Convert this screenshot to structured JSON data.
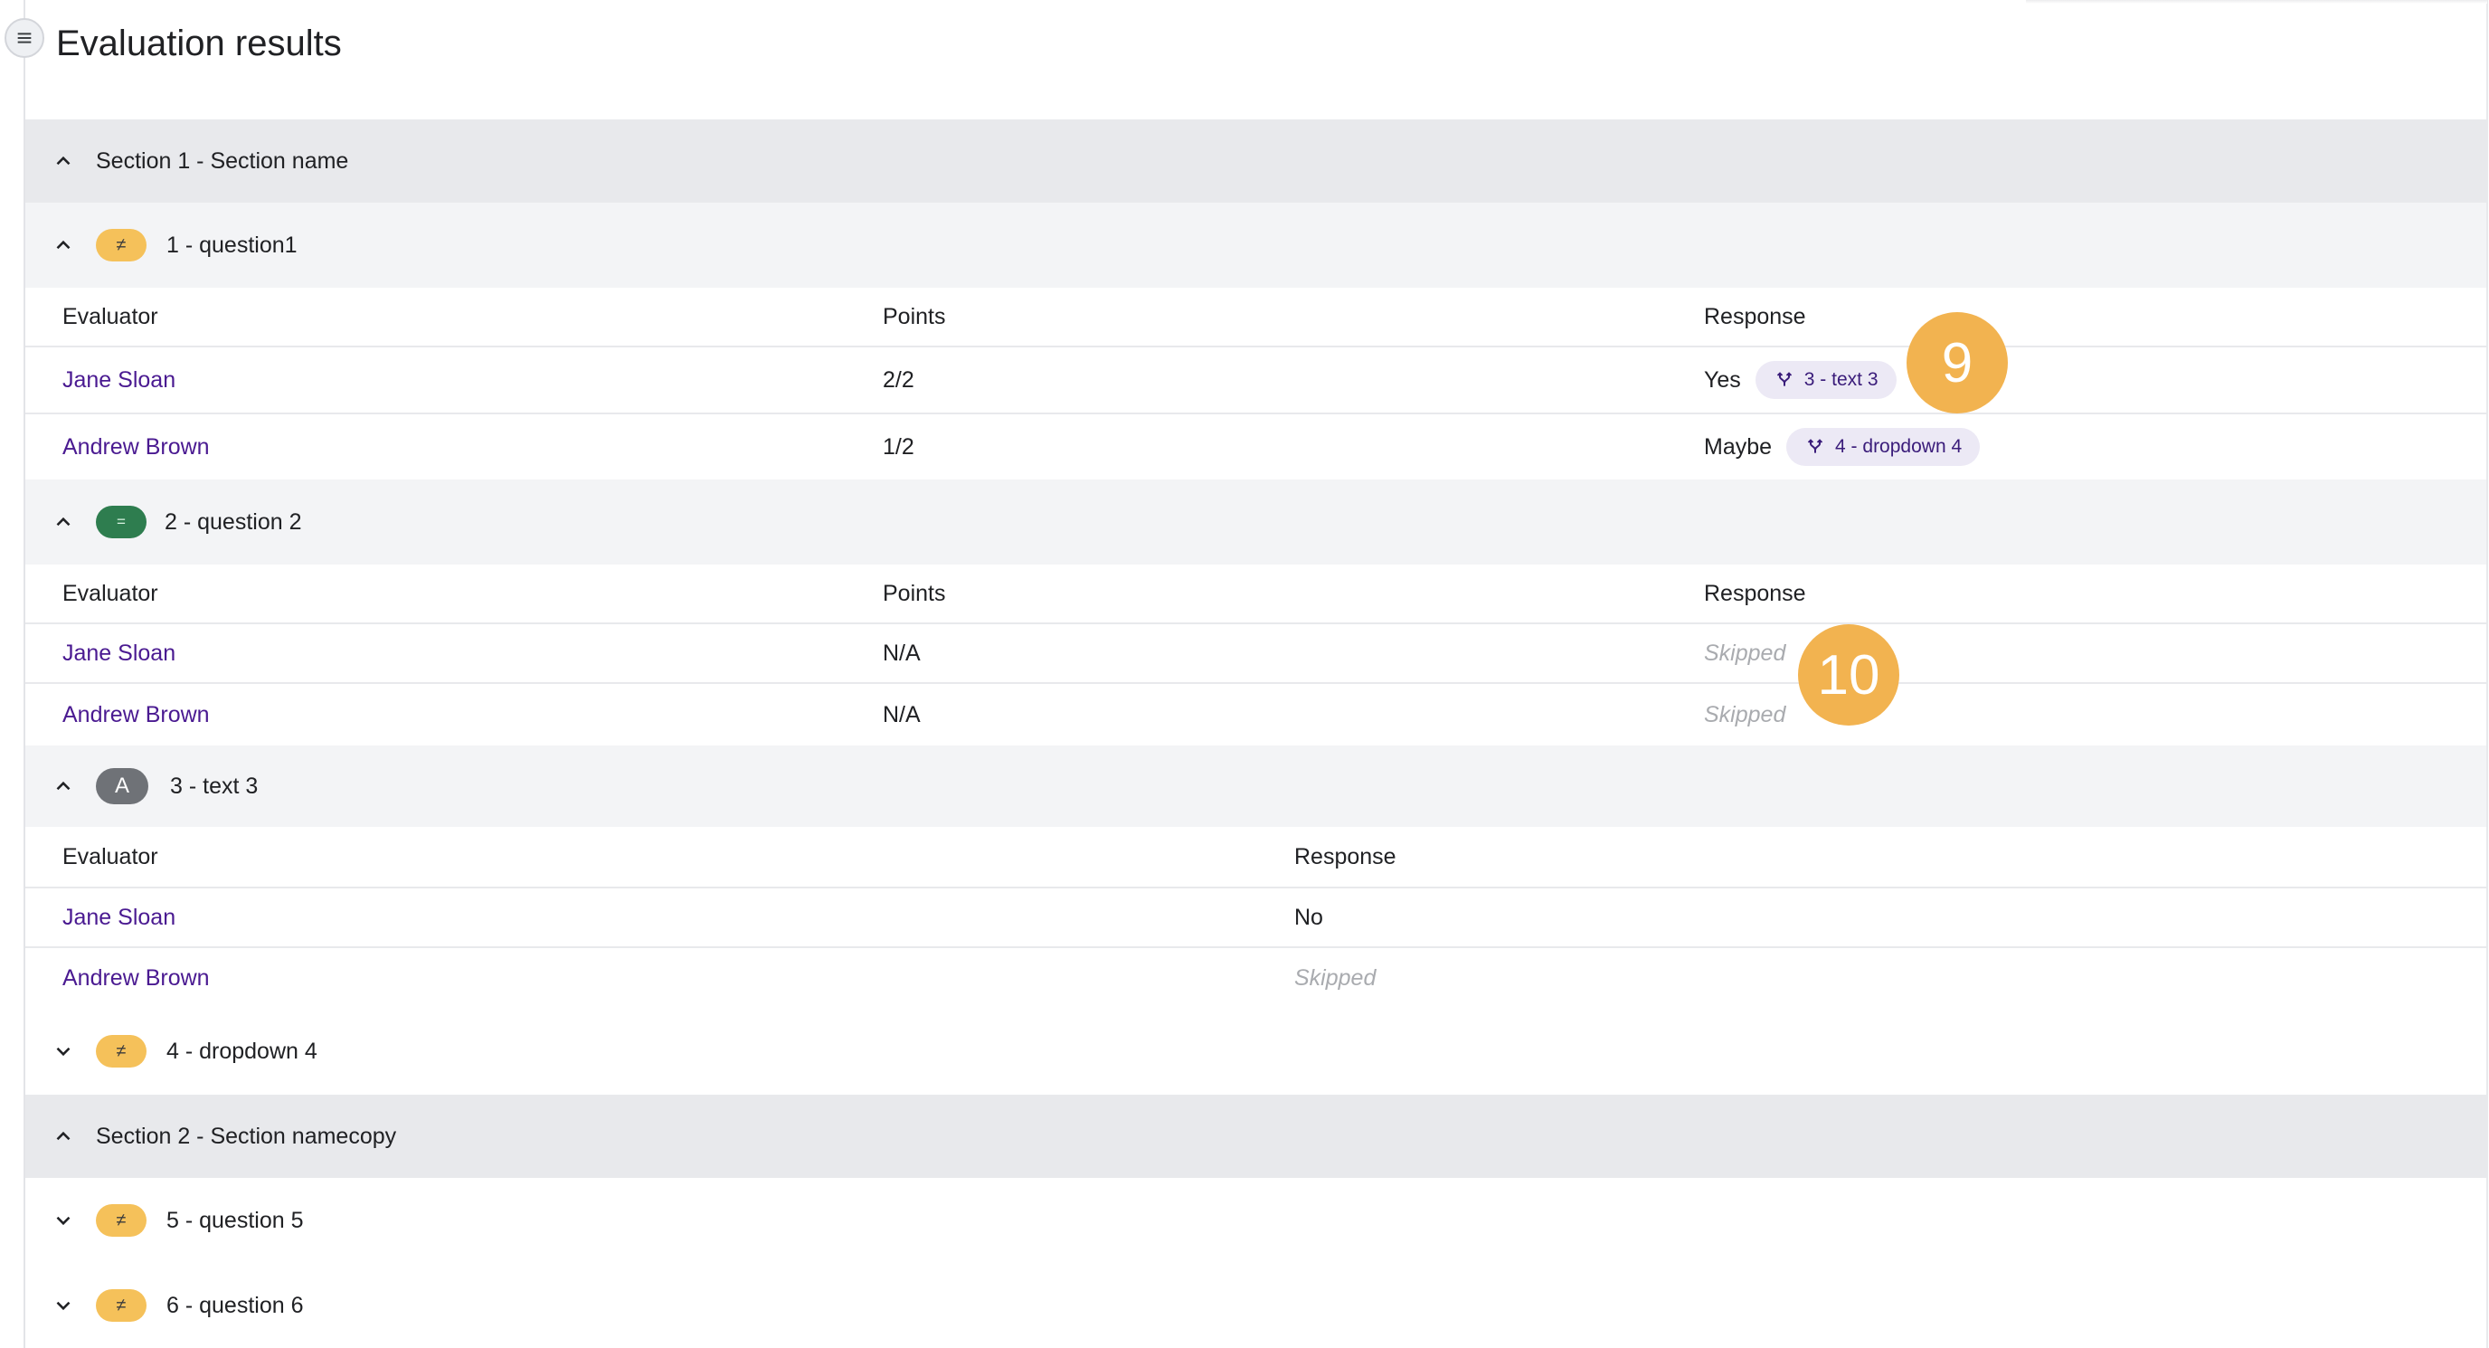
{
  "page": {
    "title": "Evaluation results"
  },
  "sections": [
    {
      "label": "Section 1 - Section name",
      "questions": [
        {
          "badge": "≠",
          "label": "1 - question1",
          "headers": {
            "evaluator": "Evaluator",
            "points": "Points",
            "response": "Response"
          },
          "rows": [
            {
              "evaluator": "Jane Sloan",
              "points": "2/2",
              "response": "Yes",
              "chip": "3 - text 3"
            },
            {
              "evaluator": "Andrew Brown",
              "points": "1/2",
              "response": "Maybe",
              "chip": "4 - dropdown 4"
            }
          ]
        },
        {
          "badge": "=",
          "label": "2 - question 2",
          "headers": {
            "evaluator": "Evaluator",
            "points": "Points",
            "response": "Response"
          },
          "rows": [
            {
              "evaluator": "Jane Sloan",
              "points": "N/A",
              "response": "Skipped"
            },
            {
              "evaluator": "Andrew Brown",
              "points": "N/A",
              "response": "Skipped"
            }
          ]
        },
        {
          "badge": "A",
          "label": "3 - text 3",
          "headers": {
            "evaluator": "Evaluator",
            "response": "Response"
          },
          "rows": [
            {
              "evaluator": "Jane Sloan",
              "response": "No"
            },
            {
              "evaluator": "Andrew Brown",
              "response": "Skipped"
            }
          ]
        },
        {
          "badge": "≠",
          "label": "4 - dropdown 4"
        }
      ]
    },
    {
      "label": "Section 2 - Section namecopy",
      "questions": [
        {
          "badge": "≠",
          "label": "5 - question 5"
        },
        {
          "badge": "≠",
          "label": "6 - question 6"
        }
      ]
    }
  ],
  "markers": [
    "9",
    "10"
  ],
  "colors": {
    "accent_link": "#4a1a91",
    "badge_neq": "#f5c15a",
    "badge_eq": "#2e7d4f",
    "badge_text": "#6f7277",
    "marker": "#f2b350"
  },
  "icons": {
    "menu": "menu-icon",
    "expand": "chevron-up-icon",
    "collapse": "chevron-down-icon",
    "branch": "branch-icon"
  }
}
